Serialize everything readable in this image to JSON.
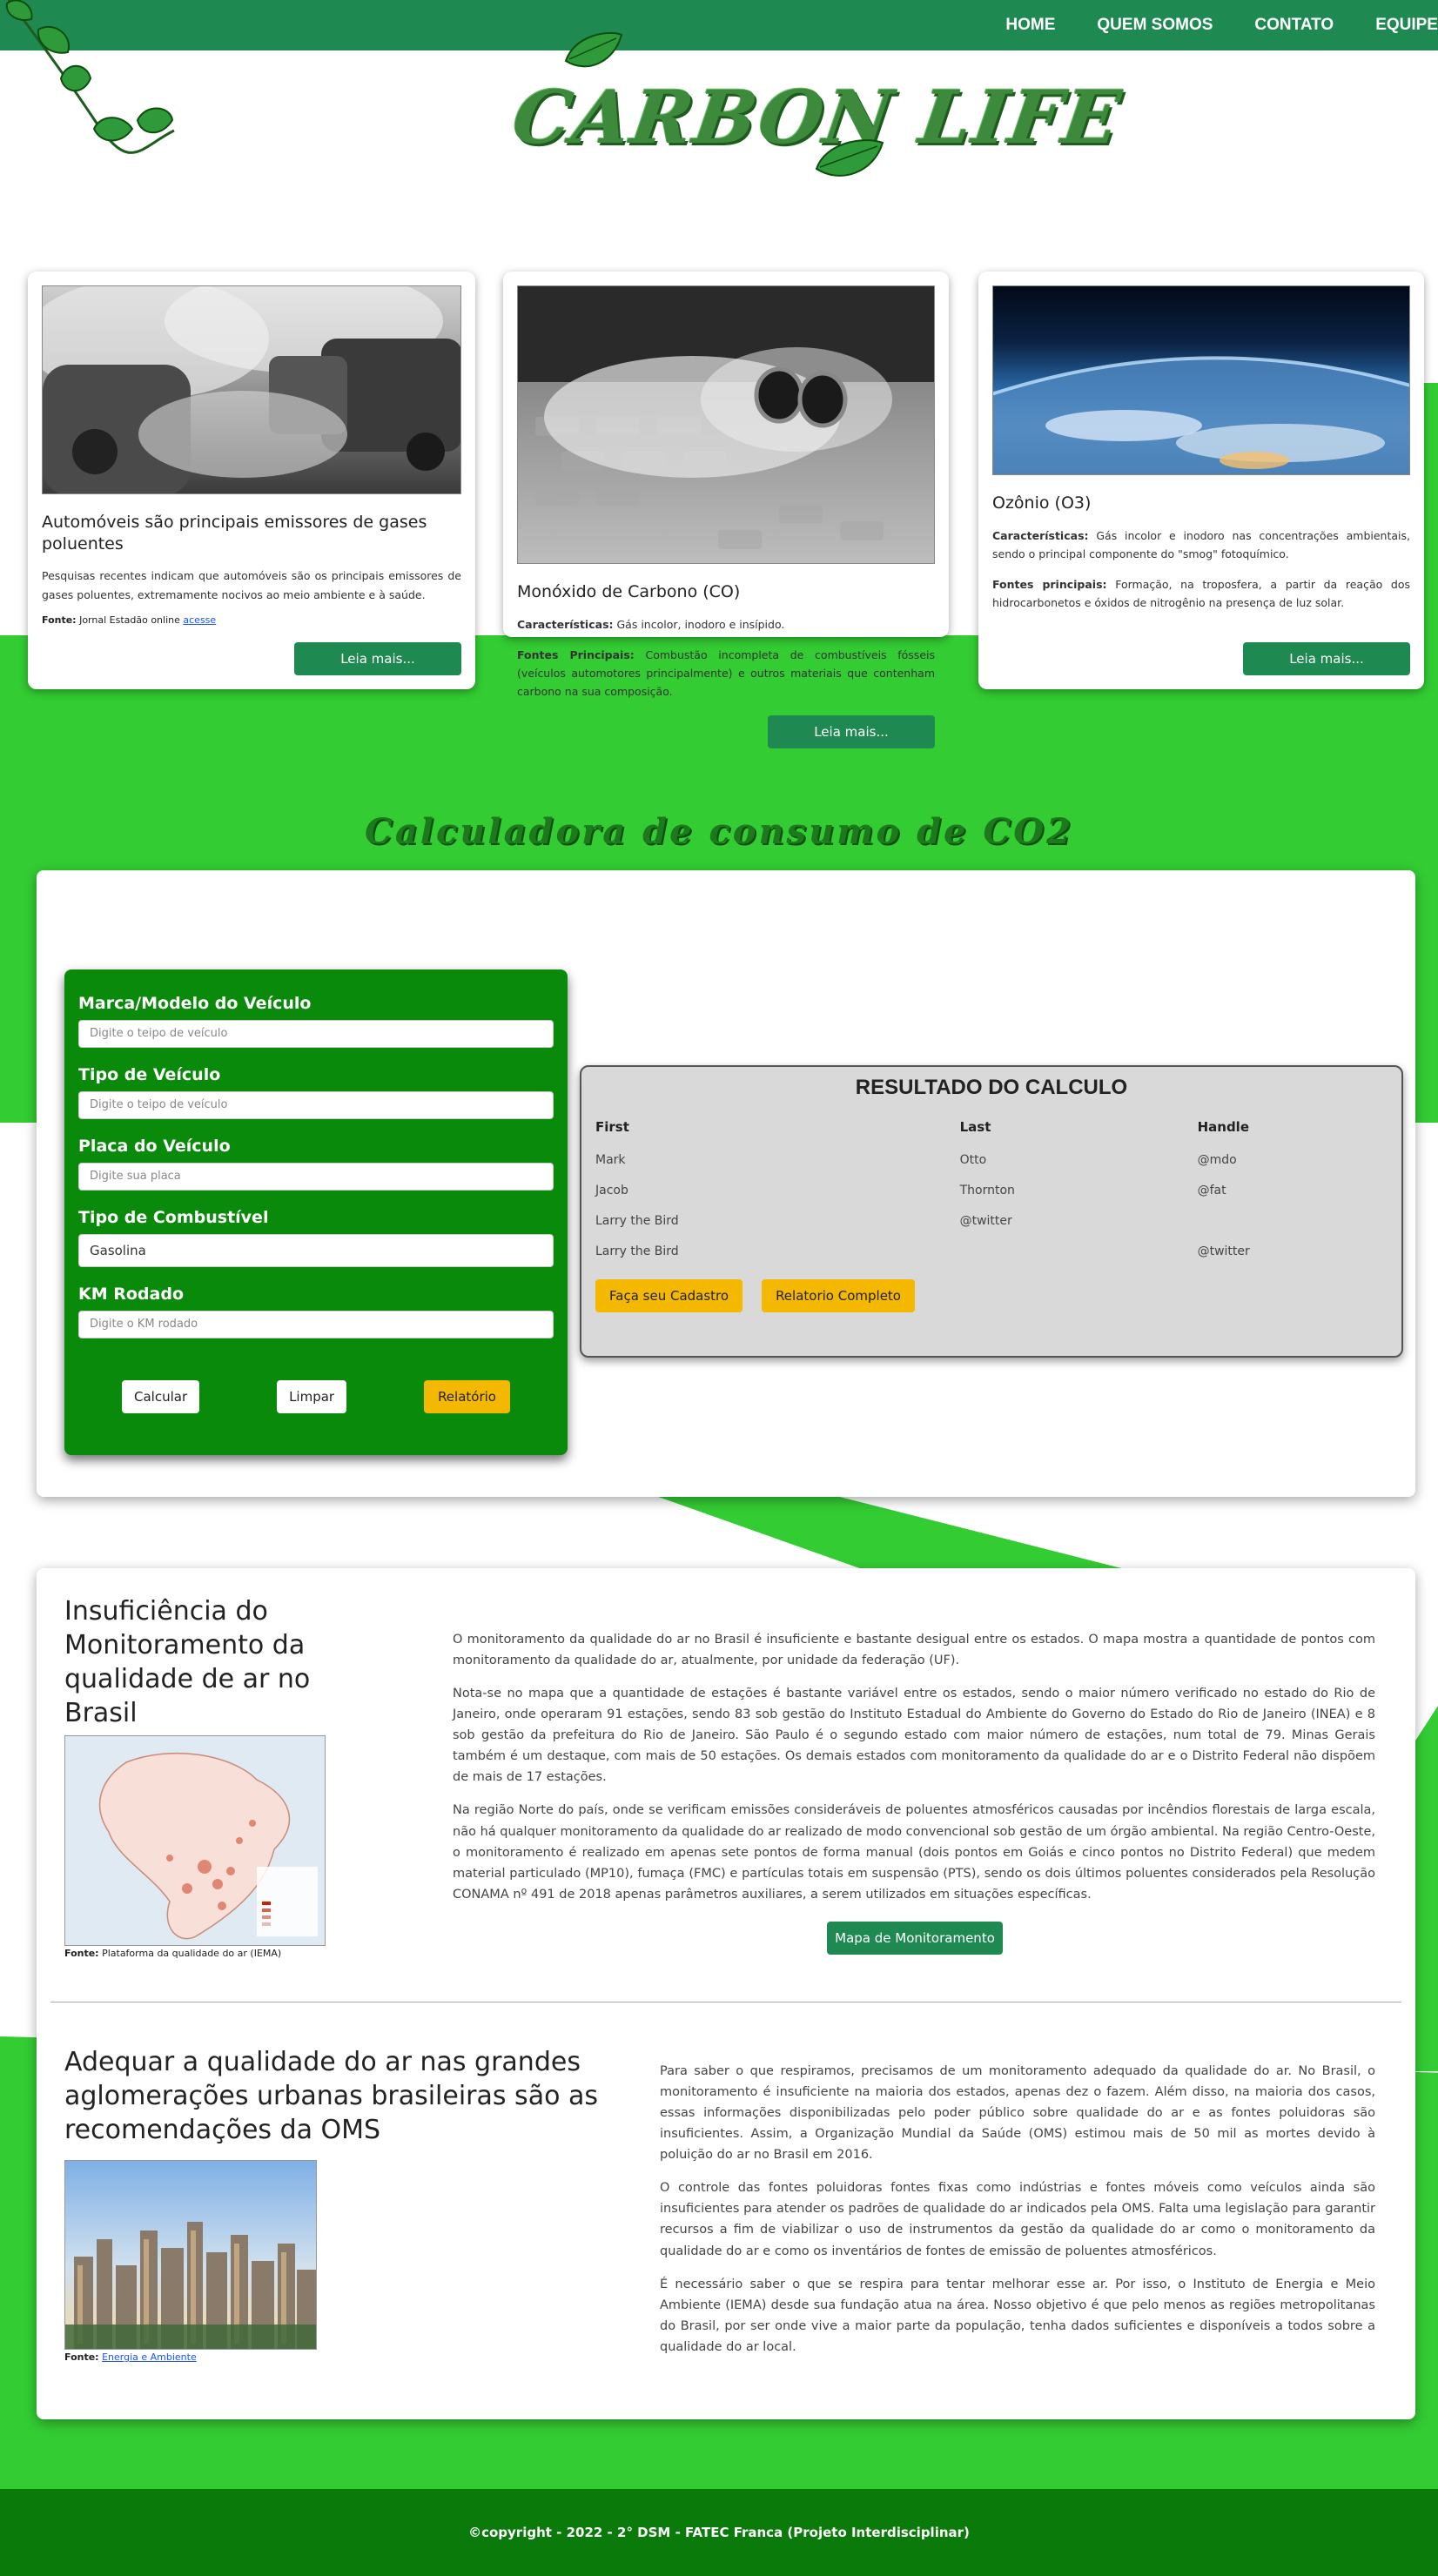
{
  "nav": {
    "links": [
      "HOME",
      "QUEM SOMOS",
      "CONTATO",
      "EQUIPE"
    ]
  },
  "logo": {
    "text": "CARBON LIFE"
  },
  "cards": [
    {
      "title": "Automóveis são principais emissores de gases poluentes",
      "text": "Pesquisas recentes indicam que automóveis são os principais emissores de gases poluentes, extremamente nocivos ao meio ambiente e à saúde.",
      "source_label": "Fonte:",
      "source_text": "Jornal Estadão online",
      "source_link": "acesse",
      "button": "Leia mais..."
    },
    {
      "title": "Monóxido de Carbono (CO)",
      "char_label": "Características:",
      "char_text": "Gás incolor, inodoro e insípido.",
      "sources_label": "Fontes Principais:",
      "sources_text": "Combustão incompleta de combustíveis fósseis (veículos automotores principalmente) e outros materiais que contenham carbono na sua composição.",
      "button": "Leia mais..."
    },
    {
      "title": "Ozônio (O3)",
      "char_label": "Características:",
      "char_text": "Gás incolor e inodoro nas concentrações ambientais, sendo o principal componente do \"smog\" fotoquímico.",
      "sources_label": "Fontes principais:",
      "sources_text": "Formação, na troposfera, a partir da reação dos hidrocarbonetos e óxidos de nitrogênio na presença de luz solar.",
      "button": "Leia mais..."
    }
  ],
  "calculator": {
    "title": "Calculadora de consumo de CO2",
    "fields": [
      {
        "label": "Marca/Modelo do Veículo",
        "placeholder": "Digite o teipo de veículo"
      },
      {
        "label": "Tipo de Veículo",
        "placeholder": "Digite o teipo de veículo"
      },
      {
        "label": "Placa do Veículo",
        "placeholder": "Digite sua placa"
      },
      {
        "label": "Tipo de Combustível",
        "value": "Gasolina"
      },
      {
        "label": "KM Rodado",
        "placeholder": "Digite o KM rodado"
      }
    ],
    "buttons": {
      "calcular": "Calcular",
      "limpar": "Limpar",
      "relatorio": "Relatório"
    }
  },
  "result": {
    "title": "RESULTADO DO CALCULO",
    "headers": [
      "First",
      "Last",
      "Handle"
    ],
    "rows": [
      [
        "Mark",
        "Otto",
        "@mdo"
      ],
      [
        "Jacob",
        "Thornton",
        "@fat"
      ],
      [
        "Larry the Bird",
        "@twitter",
        ""
      ],
      [
        "Larry the Bird",
        "",
        "@twitter"
      ]
    ],
    "buttons": {
      "cadastro": "Faça seu Cadastro",
      "relatorio": "Relatorio Completo"
    }
  },
  "info1": {
    "title": "Insuficiência do Monitoramento da qualidade de ar no Brasil",
    "paragraphs": [
      "O monitoramento da qualidade do ar no Brasil é insuficiente e bastante desigual entre os estados. O mapa mostra a quantidade de pontos com monitoramento da qualidade do ar, atualmente, por unidade da federação (UF).",
      "Nota-se no mapa que a quantidade de estações é bastante variável entre os estados, sendo o maior número verificado no estado do Rio de Janeiro, onde operaram 91 estações, sendo 83 sob gestão do Instituto Estadual do Ambiente do Governo do Estado do Rio de Janeiro (INEA) e 8 sob gestão da prefeitura do Rio de Janeiro. São Paulo é o segundo estado com maior número de estações, num total de 79. Minas Gerais também é um destaque, com mais de 50 estações. Os demais estados com monitoramento da qualidade do ar e o Distrito Federal não dispõem de mais de 17 estações.",
      "Na região Norte do país, onde se verificam emissões consideráveis de poluentes atmosféricos causadas por incêndios florestais de larga escala, não há qualquer monitoramento da qualidade do ar realizado de modo convencional sob gestão de um órgão ambiental. Na região Centro-Oeste, o monitoramento é realizado em apenas sete pontos de forma manual (dois pontos em Goiás e cinco pontos no Distrito Federal) que medem material particulado (MP10), fumaça (FMC) e partículas totais em suspensão (PTS), sendo os dois últimos poluentes considerados pela Resolução CONAMA nº 491 de 2018 apenas parâmetros auxiliares, a serem utilizados em situações específicas."
    ],
    "source_label": "Fonte:",
    "source_text": "Plataforma da qualidade do ar (IEMA)",
    "button": "Mapa de Monitoramento"
  },
  "info2": {
    "title": "Adequar a qualidade do ar nas grandes aglomerações urbanas brasileiras são as recomendações da OMS",
    "paragraphs": [
      "Para saber o que respiramos, precisamos de um monitoramento adequado da qualidade do ar. No Brasil, o monitoramento é insuficiente na maioria dos estados, apenas dez o fazem. Além disso, na maioria dos casos, essas informações disponibilizadas pelo poder público sobre qualidade do ar e as fontes poluidoras são insuficientes. Assim, a Organização Mundial da Saúde (OMS) estimou mais de 50 mil as mortes devido à poluição do ar no Brasil em 2016.",
      "O controle das fontes poluidoras fontes fixas como indústrias e fontes móveis como veículos ainda são insuficientes para atender os padrões de qualidade do ar indicados pela OMS. Falta uma legislação para garantir recursos a fim de viabilizar o uso de instrumentos da gestão da qualidade do ar como o monitoramento da qualidade do ar e como os inventários de fontes de emissão de poluentes atmosféricos.",
      "É necessário saber o que se respira para tentar melhorar esse ar. Por isso, o Instituto de Energia e Meio Ambiente (IEMA) desde sua fundação atua na área. Nosso objetivo é que pelo menos as regiões metropolitanas do Brasil, por ser onde vive a maior parte da população, tenha dados suficientes e disponíveis a todos sobre a qualidade do ar local."
    ],
    "source_label": "Fonte:",
    "source_link": "Energia e Ambiente"
  },
  "footer": {
    "text": "©copyright - 2022 - 2° DSM - FATEC Franca (Projeto Interdisciplinar)"
  },
  "colors": {
    "navbar": "#1e8a52",
    "accent_green": "#33cc33",
    "form_green": "#0a8a0a",
    "button_green": "#1e8a52",
    "button_yellow": "#f5b800",
    "footer": "#0a7a0a"
  }
}
